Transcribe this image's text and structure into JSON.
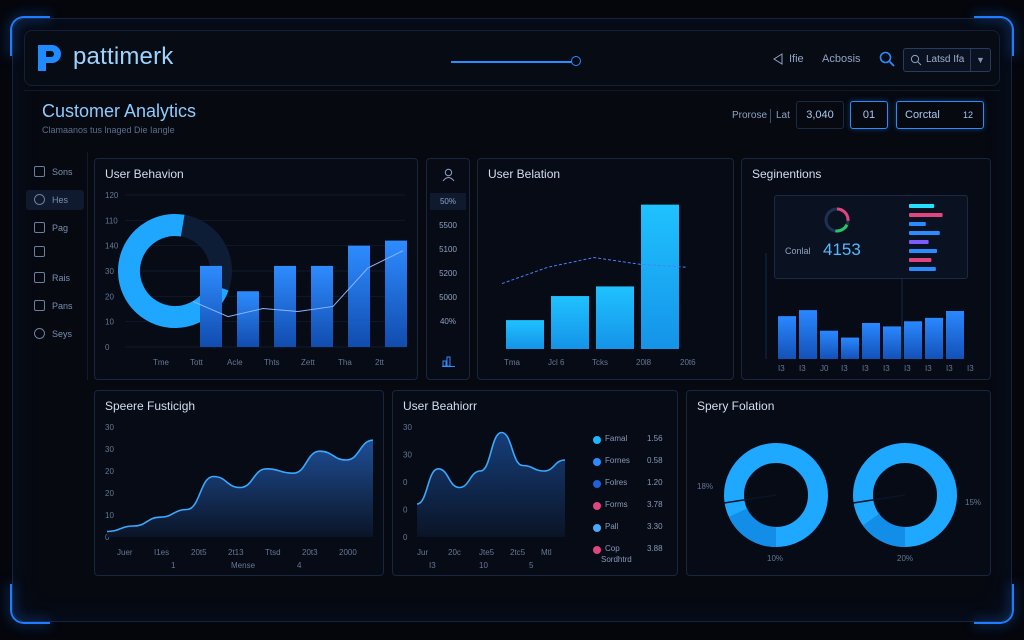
{
  "app": {
    "brand": "pattimerk",
    "nav": [
      "Ifie",
      "Acbosis"
    ],
    "search_text": "Latsd Ifa"
  },
  "header": {
    "title": "Customer Analytics",
    "subtitle": "Clamaanos tus lnaged Die Iangle",
    "label_1": "Prorose",
    "label_2": "Lat",
    "value_box": "3,040",
    "box_2": "01",
    "box_3_label": "Corctal",
    "box_3_value": "12"
  },
  "sidebar": {
    "items": [
      {
        "label": "Sons"
      },
      {
        "label": "Hes"
      },
      {
        "label": "Pag"
      },
      {
        "label": ""
      },
      {
        "label": "Rais"
      },
      {
        "label": "Pans"
      },
      {
        "label": "Seys"
      }
    ]
  },
  "panels": {
    "user_behavior": {
      "title": "User Behavion"
    },
    "mini_column": {
      "values": [
        "50%",
        "5500",
        "5100",
        "5200",
        "5000",
        "40%"
      ]
    },
    "user_relation": {
      "title": "User Belation"
    },
    "segmentations": {
      "title": "Seginentions",
      "kpi_label": "Conlal",
      "kpi_value": "4153"
    },
    "spend_forecast": {
      "title": "Speere Fusticigh"
    },
    "user_behavior_2": {
      "title": "User Beahiorr"
    },
    "spend_relation": {
      "title": "Spery Folation"
    }
  },
  "legend_2": [
    {
      "name": "Famal",
      "value": "1.56",
      "color": "#19b8ff"
    },
    {
      "name": "Fornes",
      "value": "0.58",
      "color": "#2b8cff"
    },
    {
      "name": "Folres",
      "value": "1.20",
      "color": "#1f5fd8"
    },
    {
      "name": "Forms",
      "value": "3.78",
      "color": "#e0457f"
    },
    {
      "name": "Pall",
      "value": "3.30",
      "color": "#4aa8ff"
    },
    {
      "name": "Cop",
      "value": "3.88",
      "color": "#e0457f",
      "note": "Sordhtrd"
    }
  ],
  "chart_data": [
    {
      "type": "bar",
      "title": "User Behavion",
      "categories": [
        "Tme",
        "Tott",
        "Acle",
        "Thts",
        "Zett",
        "Tha",
        "2tt"
      ],
      "values": [
        80,
        55,
        80,
        80,
        100,
        105
      ],
      "line": [
        45,
        30,
        38,
        35,
        40,
        78,
        95
      ],
      "donut_fraction": 0.72,
      "yticks": [
        "120",
        "110",
        "140",
        "30",
        "20",
        "10",
        "0"
      ],
      "ylim": [
        0,
        150
      ]
    },
    {
      "type": "bar",
      "title": "User Belation",
      "categories": [
        "Tma",
        "Jcl 6",
        "Tcks",
        "20l8",
        "20t6"
      ],
      "values": [
        30,
        55,
        65,
        150
      ],
      "line": [
        68,
        85,
        95,
        88,
        85
      ],
      "ylim": [
        0,
        160
      ]
    },
    {
      "type": "bar",
      "title": "Seginentions",
      "categories": [
        "I3",
        "I3",
        "J0",
        "I3",
        "I3",
        "I3",
        "I3",
        "I3",
        "I3",
        "I3"
      ],
      "values": [
        50,
        57,
        33,
        25,
        42,
        38,
        44,
        48,
        56
      ],
      "ylim": [
        0,
        70
      ],
      "legend_bars": [
        0.45,
        0.6,
        0.3,
        0.55,
        0.35,
        0.5,
        0.4,
        0.48
      ]
    },
    {
      "type": "area",
      "title": "Speere Fusticigh",
      "x": [
        "Juer",
        "I1es",
        "20t5",
        "2t13",
        "Ttsd",
        "20t3",
        "2000"
      ],
      "xlabel_row2": [
        "1",
        "Mense",
        "4"
      ],
      "yticks": [
        "30",
        "30",
        "20",
        "20",
        "10",
        "0"
      ],
      "values": [
        5,
        10,
        18,
        25,
        55,
        45,
        62,
        58,
        78,
        70,
        88
      ],
      "ylim": [
        0,
        100
      ]
    },
    {
      "type": "line",
      "title": "User Beahiorr",
      "x": [
        "Jur",
        "20c",
        "Jte5",
        "2tc5",
        "Mtl"
      ],
      "xlabel_row2": [
        "I3",
        "10",
        "5"
      ],
      "yticks": [
        "30",
        "30",
        "0",
        "0",
        "0"
      ],
      "values": [
        30,
        62,
        45,
        60,
        95,
        65,
        60,
        70
      ],
      "ylim": [
        0,
        100
      ]
    },
    {
      "type": "pie",
      "title": "Spery Folation",
      "slices": [
        {
          "label": "18%",
          "value": 18
        },
        {
          "label": "10%",
          "value": 82
        }
      ],
      "slices_2": [
        {
          "label": "15%",
          "value": 15
        },
        {
          "label": "20%",
          "value": 85
        }
      ]
    }
  ]
}
